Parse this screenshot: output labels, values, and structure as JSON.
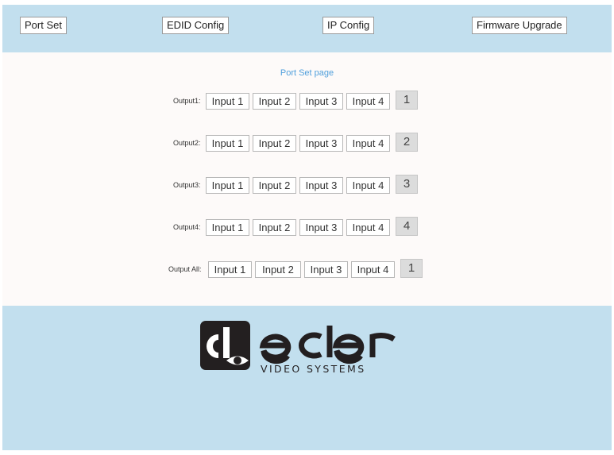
{
  "nav": {
    "items": [
      {
        "label": "Port Set"
      },
      {
        "label": "EDID Config"
      },
      {
        "label": "IP Config"
      },
      {
        "label": "Firmware Upgrade"
      }
    ]
  },
  "main": {
    "title": "Port Set page",
    "rows": [
      {
        "label": "Output1:",
        "inputs": [
          "Input 1",
          "Input 2",
          "Input 3",
          "Input 4"
        ],
        "selected": "1"
      },
      {
        "label": "Output2:",
        "inputs": [
          "Input 1",
          "Input 2",
          "Input 3",
          "Input 4"
        ],
        "selected": "2"
      },
      {
        "label": "Output3:",
        "inputs": [
          "Input 1",
          "Input 2",
          "Input 3",
          "Input 4"
        ],
        "selected": "3"
      },
      {
        "label": "Output4:",
        "inputs": [
          "Input 1",
          "Input 2",
          "Input 3",
          "Input 4"
        ],
        "selected": "4"
      },
      {
        "label": "Output All:",
        "inputs": [
          "Input 1",
          "Input 2",
          "Input 3",
          "Input 4"
        ],
        "selected": "1"
      }
    ]
  },
  "footer": {
    "logo_brand": "ecler",
    "logo_tagline": "VIDEO SYSTEMS"
  },
  "colors": {
    "header_bg": "#c2dfee",
    "content_bg": "#fdfaf9",
    "title_accent": "#4f9fdc",
    "logo_dark": "#231f20"
  }
}
